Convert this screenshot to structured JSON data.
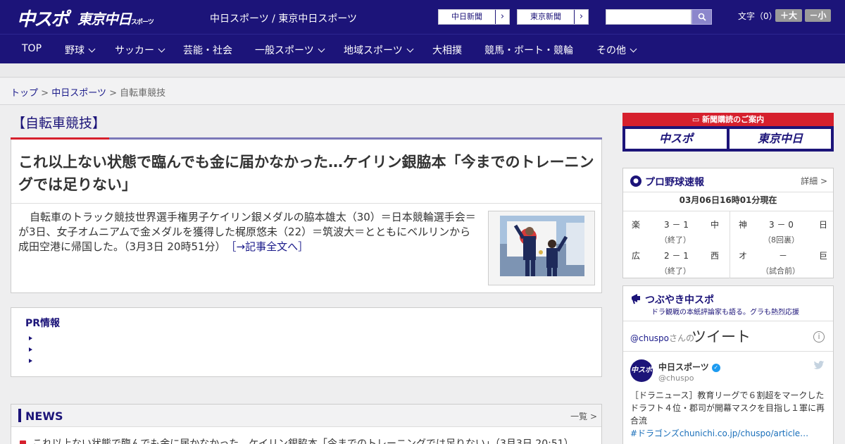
{
  "header": {
    "logo_main": "中スポ",
    "logo_tokyo": "東京中日",
    "logo_tokyo_small": "スポーツ",
    "tagline": "中日スポーツ / 東京中日スポーツ",
    "paper1": "中日新聞",
    "paper2": "東京新聞",
    "search_placeholder": "",
    "font_label": "文字（0）",
    "font_up": "＋大",
    "font_down": "－小"
  },
  "nav": {
    "items": [
      {
        "label": "TOP"
      },
      {
        "label": "野球"
      },
      {
        "label": "サッカー"
      },
      {
        "label": "芸能・社会"
      },
      {
        "label": "一般スポーツ"
      },
      {
        "label": "地域スポーツ"
      },
      {
        "label": "大相撲"
      },
      {
        "label": "競馬・ボート・競輪"
      },
      {
        "label": "その他"
      }
    ]
  },
  "breadcrumb": {
    "top": "トップ",
    "sep": ">",
    "section": "中日スポーツ",
    "current": "自転車競技"
  },
  "section_title": "【自転車競技】",
  "article": {
    "headline": "これ以上ない状態で臨んでも金に届かなかった…ケイリン銀脇本「今までのトレーニングでは足りない」",
    "body": "自転車のトラック競技世界選手権男子ケイリン銀メダルの脇本雄太（30）＝日本競輪選手会＝が3日、女子オムニアムで金メダルを獲得した梶原悠未（22）＝筑波大＝とともにベルリンから成田空港に帰国した。（3月3日 20時51分）",
    "read_more": "［→記事全文へ］"
  },
  "pr": {
    "title": "PR情報"
  },
  "news": {
    "title": "NEWS",
    "more": "一覧 >",
    "items": [
      {
        "text": "これ以上ない状態で臨んでも金に届かなかった…ケイリン銀脇本「今までのトレーニングでは足りない」（3月3日 20:51）"
      }
    ]
  },
  "subscribe": {
    "label": "新聞購読のご案内",
    "btn1": "中スポ",
    "btn2": "東京中日"
  },
  "baseball": {
    "title": "プロ野球速報",
    "more": "詳細 >",
    "timestamp": "03月06日16時01分現在",
    "games": [
      {
        "home": "楽",
        "score": "3 － 1",
        "away": "中",
        "status": "（終了）"
      },
      {
        "home": "神",
        "score": "3 － 0",
        "away": "日",
        "status": "（8回裏）"
      },
      {
        "home": "広",
        "score": "2 － 1",
        "away": "西",
        "status": "（終了）"
      },
      {
        "home": "オ",
        "score": "－",
        "away": "巨",
        "status": "（試合前）"
      }
    ]
  },
  "twitter": {
    "title": "つぶやき中スポ",
    "subtitle": "ドラ観戦の本紙評論家も語る。グラも熱烈応援",
    "at": "@chuspo",
    "san": "さんの",
    "heading": "ツイート",
    "info": "i",
    "avatar": "中スポ",
    "name": "中日スポーツ",
    "handle": "@chuspo",
    "tweet": "［ドラニュース］教育リーグで６割超をマークしたドラフト４位・郡司が開幕マスクを目指し１軍に再合流",
    "tweet_link": "#ドラゴンズchunichi.co.jp/chuspo/article…"
  },
  "colors": {
    "brand": "#1c1479",
    "accent": "#d6202d"
  }
}
